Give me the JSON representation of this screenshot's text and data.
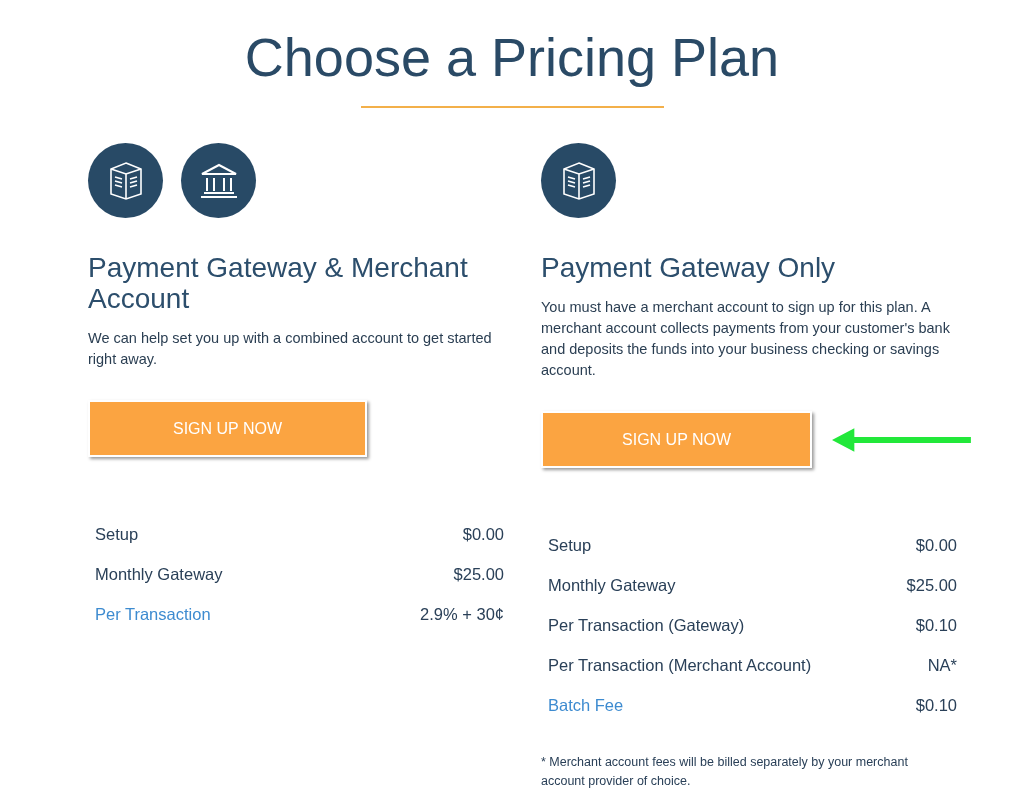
{
  "title": "Choose a Pricing Plan",
  "plans": [
    {
      "icons": [
        {
          "kind": "server"
        },
        {
          "kind": "bank"
        }
      ],
      "heading": "Payment Gateway & Merchant Account",
      "description": "We can help set you up with a combined account to get started right away.",
      "button": "SIGN UP NOW",
      "highlighted": false,
      "fees": [
        {
          "label": "Setup",
          "value": "$0.00",
          "kind": "plain"
        },
        {
          "label": "Monthly Gateway",
          "value": "$25.00",
          "kind": "plain"
        },
        {
          "label": "Per Transaction",
          "value": "2.9% + 30¢",
          "kind": "link"
        }
      ]
    },
    {
      "icons": [
        {
          "kind": "server"
        }
      ],
      "heading": "Payment Gateway Only",
      "description": "You must have a merchant account to sign up for this plan. A merchant account collects payments from your customer's bank and deposits the funds into your business checking or savings account.",
      "button": "SIGN UP NOW",
      "highlighted": true,
      "fees": [
        {
          "label": "Setup",
          "value": "$0.00",
          "kind": "plain"
        },
        {
          "label": "Monthly Gateway",
          "value": "$25.00",
          "kind": "plain"
        },
        {
          "label": "Per Transaction (Gateway)",
          "value": "$0.10",
          "kind": "plain"
        },
        {
          "label": "Per Transaction (Merchant Account)",
          "value": "NA*",
          "kind": "plain"
        },
        {
          "label": "Batch Fee",
          "value": "$0.10",
          "kind": "link"
        }
      ],
      "footnote": "* Merchant account fees will be billed separately by your merchant account provider of choice."
    }
  ]
}
